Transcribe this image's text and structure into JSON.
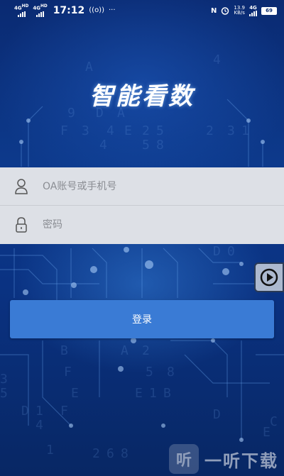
{
  "status_bar": {
    "net1": "4G",
    "net1_sub": "HD",
    "net2": "4G",
    "net2_sub": "HD",
    "time": "17:12",
    "hotspot_icon": "((o))",
    "more": "···",
    "nfc_icon": "N",
    "alarm_icon": "alarm-icon",
    "speed_value": "13.9",
    "speed_unit": "KB/s",
    "net3": "4G",
    "battery": "69"
  },
  "app": {
    "title": "智能看数"
  },
  "form": {
    "username_placeholder": "OA账号或手机号",
    "password_placeholder": "密码",
    "username_value": "",
    "password_value": ""
  },
  "login": {
    "label": "登录"
  },
  "watermark": {
    "logo_text": "听",
    "text": "一听下载"
  },
  "colors": {
    "accent": "#3a7bd5",
    "background": "#0b2b6e",
    "form_background": "#dde0e6"
  }
}
